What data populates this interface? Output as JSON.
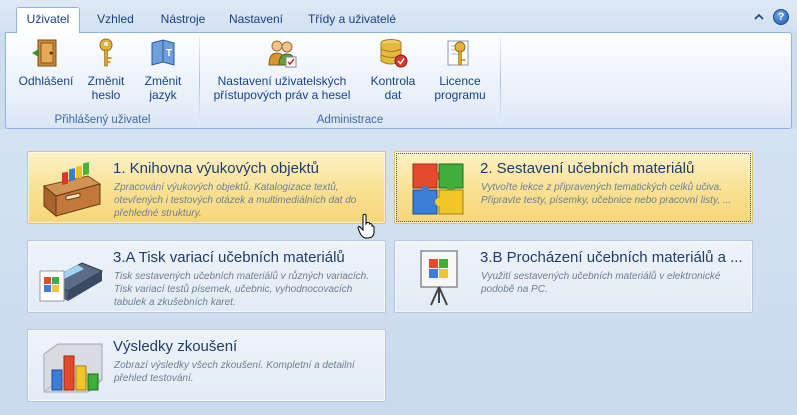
{
  "tabs": [
    {
      "label": "Uživatel",
      "active": true
    },
    {
      "label": "Vzhled",
      "active": false
    },
    {
      "label": "Nástroje",
      "active": false
    },
    {
      "label": "Nastavení",
      "active": false
    },
    {
      "label": "Třídy a uživatelé",
      "active": false
    }
  ],
  "window_controls": {
    "collapse_icon": "chevron-up-icon",
    "help_icon": "help-icon",
    "help_glyph": "?"
  },
  "ribbon": {
    "groups": [
      {
        "label": "Přihlášený uživatel",
        "buttons": [
          {
            "label": "Odhlášení",
            "icon": "logout-door-icon"
          },
          {
            "label": "Změnit heslo",
            "icon": "key-icon"
          },
          {
            "label": "Změnit jazyk",
            "icon": "language-book-icon"
          }
        ]
      },
      {
        "label": "Administrace",
        "buttons": [
          {
            "label": "Nastavení uživatelských přístupových práv a hesel",
            "icon": "user-rights-icon"
          },
          {
            "label": "Kontrola dat",
            "icon": "database-check-icon"
          },
          {
            "label": "Licence programu",
            "icon": "license-key-icon"
          }
        ]
      }
    ]
  },
  "tiles": [
    {
      "title": "1. Knihovna výukových objektů",
      "desc": "Zpracování výukových objektů. Katalogizace textů, otevřených i testových otázek a multimediálních dat do přehledné struktury.",
      "icon": "drawer-cabinet-icon",
      "highlighted": true
    },
    {
      "title": "2. Sestavení učebních materiálů",
      "desc": "Vytvořte lekce z připravených tematických celků učiva. Připravte testy, písemky, učebnice nebo pracovní listy, ...",
      "icon": "puzzle-pieces-icon",
      "highlighted": true
    },
    {
      "title": "3.A Tisk variací učebních materiálů",
      "desc": "Tisk sestavených učebních materiálů v různých variacích. Tisk variací testů písemek, učebnic, vyhodnocovacích tabulek a zkušebních karet.",
      "icon": "printer-icon",
      "highlighted": false
    },
    {
      "title": "3.B Procházení učebních materiálů a ...",
      "desc": "Využití sestavených učebních materiálů v elektronické podobě na PC.",
      "icon": "presentation-board-icon",
      "highlighted": false
    },
    {
      "title": "Výsledky zkoušení",
      "desc": "Zobrazí výsledky všech zkoušení. Kompletní a detailní přehled testování.",
      "icon": "bar-chart-icon",
      "highlighted": false
    }
  ],
  "colors": {
    "accent": "#15428b",
    "highlight": "#f9df8e",
    "background": "#cfdcee"
  }
}
